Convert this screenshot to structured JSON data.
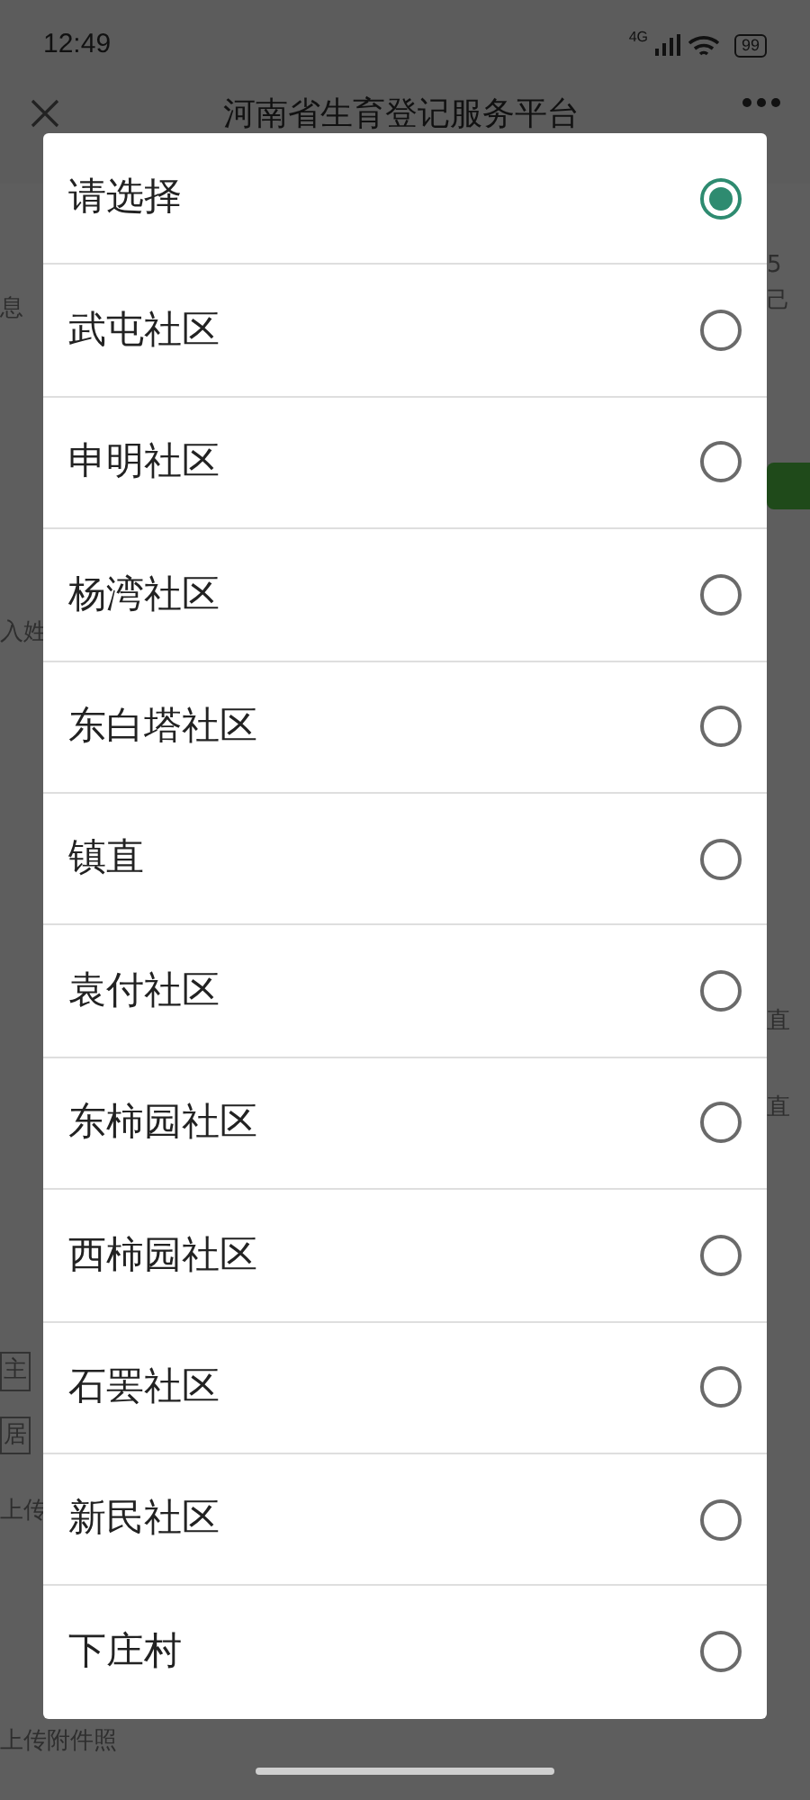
{
  "status_bar": {
    "time": "12:49",
    "network": "4G",
    "battery": "99"
  },
  "header": {
    "title": "河南省生育登记服务平台"
  },
  "background": {
    "tab_left": "息",
    "tab_right_count": "5",
    "tab_right": "己",
    "name_hint": "入姓",
    "level_1": "直",
    "level_2": "直",
    "tag_1": "主",
    "tag_2": "居",
    "upload_1": "上传",
    "upload_2": "上传附件照"
  },
  "options": [
    {
      "label": "请选择",
      "selected": true
    },
    {
      "label": "武屯社区",
      "selected": false
    },
    {
      "label": "申明社区",
      "selected": false
    },
    {
      "label": "杨湾社区",
      "selected": false
    },
    {
      "label": "东白塔社区",
      "selected": false
    },
    {
      "label": "镇直",
      "selected": false
    },
    {
      "label": "袁付社区",
      "selected": false
    },
    {
      "label": "东柿园社区",
      "selected": false
    },
    {
      "label": "西柿园社区",
      "selected": false
    },
    {
      "label": "石罢社区",
      "selected": false
    },
    {
      "label": "新民社区",
      "selected": false
    },
    {
      "label": "下庄村",
      "selected": false
    }
  ]
}
